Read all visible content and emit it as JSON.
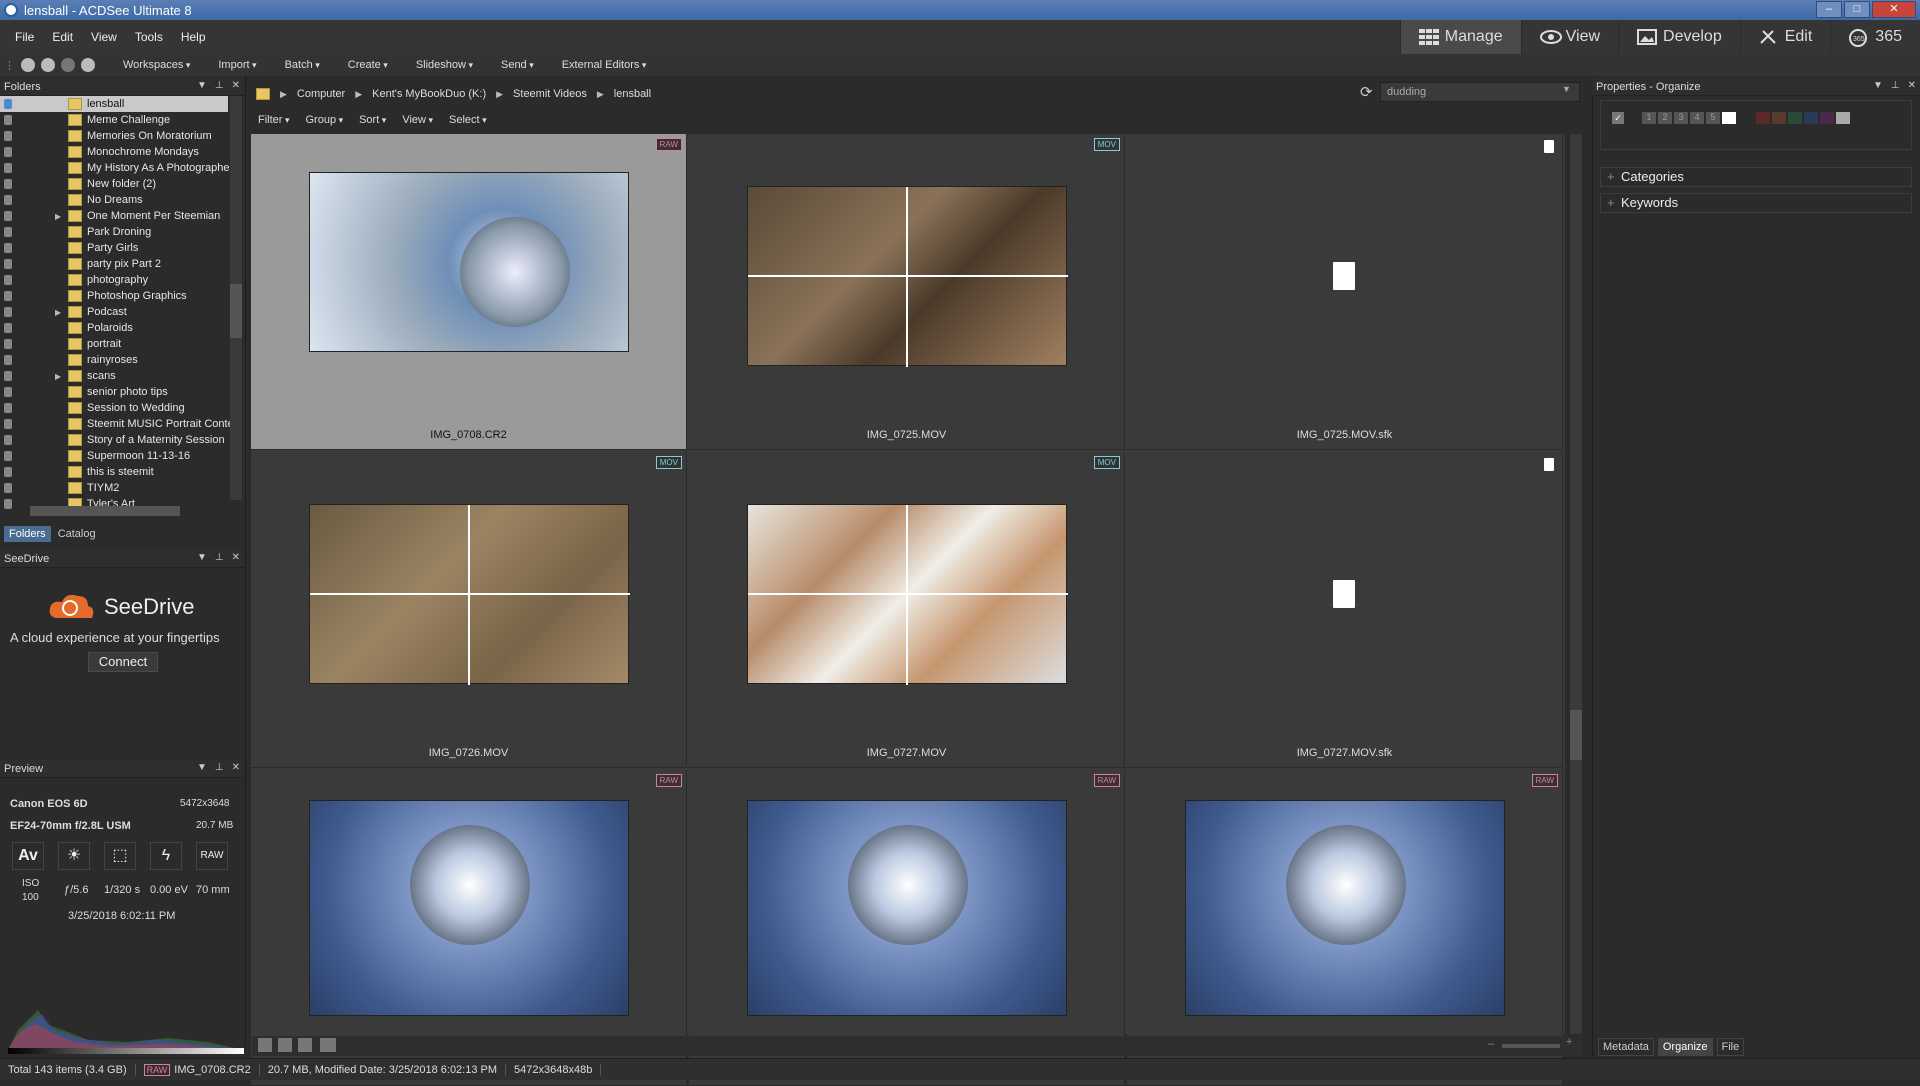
{
  "window": {
    "title": "lensball - ACDSee Ultimate 8"
  },
  "menu": [
    "File",
    "Edit",
    "View",
    "Tools",
    "Help"
  ],
  "modes": [
    {
      "label": "Manage",
      "icon": "grid-icon"
    },
    {
      "label": "View",
      "icon": "eye-icon"
    },
    {
      "label": "Develop",
      "icon": "develop-icon"
    },
    {
      "label": "Edit",
      "icon": "edit-icon"
    },
    {
      "label": "365",
      "icon": "cloud-365-icon"
    }
  ],
  "toolbar": [
    "Workspaces",
    "Import",
    "Batch",
    "Create",
    "Slideshow",
    "Send",
    "External Editors"
  ],
  "folders_panel": {
    "title": "Folders"
  },
  "folders": [
    {
      "name": "lensball",
      "selected": true
    },
    {
      "name": "Meme Challenge"
    },
    {
      "name": "Memories On Moratorium"
    },
    {
      "name": "Monochrome Mondays"
    },
    {
      "name": "My History As A Photographer"
    },
    {
      "name": "New folder (2)"
    },
    {
      "name": "No Dreams"
    },
    {
      "name": "One Moment Per Steemian",
      "expandable": true
    },
    {
      "name": "Park Droning"
    },
    {
      "name": "Party Girls"
    },
    {
      "name": "party pix Part 2"
    },
    {
      "name": "photography"
    },
    {
      "name": "Photoshop Graphics"
    },
    {
      "name": "Podcast",
      "expandable": true
    },
    {
      "name": "Polaroids"
    },
    {
      "name": "portrait"
    },
    {
      "name": "rainyroses"
    },
    {
      "name": "scans",
      "expandable": true
    },
    {
      "name": "senior photo tips"
    },
    {
      "name": "Session to Wedding"
    },
    {
      "name": "Steemit MUSIC Portrait Contest"
    },
    {
      "name": "Story of a Maternity Session"
    },
    {
      "name": "Supermoon 11-13-16"
    },
    {
      "name": "this is steemit"
    },
    {
      "name": "TIYM2"
    },
    {
      "name": "Tyler's Art"
    }
  ],
  "left_tabs": [
    "Folders",
    "Catalog"
  ],
  "seedrive": {
    "title": "SeeDrive",
    "brand": "SeeDrive",
    "tagline": "A cloud experience at your fingertips",
    "connect": "Connect"
  },
  "preview": {
    "title": "Preview",
    "camera": "Canon EOS 6D",
    "dimensions": "5472x3648",
    "lens": "EF24-70mm f/2.8L USM",
    "size": "20.7 MB",
    "mode": "Av",
    "format": "RAW",
    "iso_label": "ISO",
    "iso": "100",
    "aperture": "ƒ/5.6",
    "shutter": "1/320 s",
    "ev": "0.00 eV",
    "focal": "70 mm",
    "date": "3/25/2018 6:02:11 PM"
  },
  "breadcrumb": [
    "Computer",
    "Kent's MyBookDuo (K:)",
    "Steemit Videos",
    "lensball"
  ],
  "search": {
    "value": "dudding"
  },
  "filters": [
    "Filter",
    "Group",
    "Sort",
    "View",
    "Select"
  ],
  "files": [
    {
      "name": "IMG_0708.CR2",
      "badge": "RAW",
      "selected": true,
      "thumb": "lensball-blue"
    },
    {
      "name": "IMG_0725.MOV",
      "badge": "MOV",
      "thumb": "dirt-glass"
    },
    {
      "name": "IMG_0725.MOV.sfk",
      "badge": "",
      "thumb": "file"
    },
    {
      "name": "IMG_0726.MOV",
      "badge": "MOV",
      "thumb": "ground"
    },
    {
      "name": "IMG_0727.MOV",
      "badge": "MOV",
      "thumb": "faces"
    },
    {
      "name": "IMG_0727.MOV.sfk",
      "badge": "",
      "thumb": "file"
    },
    {
      "name": "",
      "badge": "RAW",
      "thumb": "lensball-tree"
    },
    {
      "name": "",
      "badge": "RAW",
      "thumb": "lensball-tree"
    },
    {
      "name": "",
      "badge": "RAW",
      "thumb": "lensball-tree"
    }
  ],
  "properties": {
    "title": "Properties - Organize",
    "ratings": [
      "1",
      "2",
      "3",
      "4",
      "5"
    ],
    "sections": [
      "Categories",
      "Keywords"
    ]
  },
  "right_tabs": [
    "Metadata",
    "Organize",
    "File"
  ],
  "status": {
    "total": "Total 143 items  (3.4 GB)",
    "badge": "RAW",
    "file": "IMG_0708.CR2",
    "info": "20.7 MB, Modified Date: 3/25/2018 6:02:13 PM",
    "dims": "5472x3648x48b"
  }
}
